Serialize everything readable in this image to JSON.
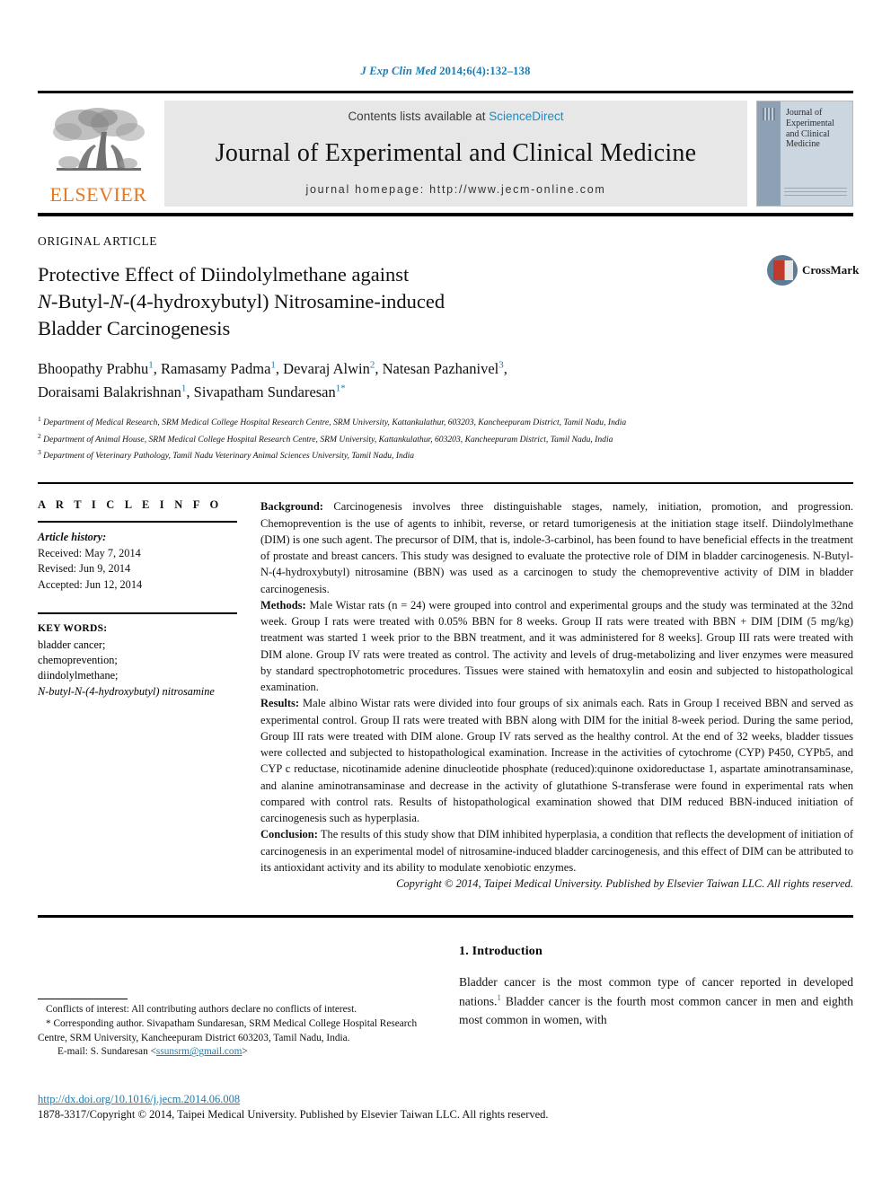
{
  "running_head": {
    "italic_part": "J Exp Clin Med",
    "rest": " 2014;6(4):132–138"
  },
  "masthead": {
    "contents_prefix": "Contents lists available at ",
    "sciencedirect": "ScienceDirect",
    "journal_name": "Journal of Experimental and Clinical Medicine",
    "homepage": "journal homepage: http://www.jecm-online.com",
    "elsevier_wordmark": "ELSEVIER",
    "cover_title": "Journal of Experimental and Clinical Medicine"
  },
  "article": {
    "kicker": "ORIGINAL ARTICLE",
    "title_line1": "Protective Effect of Diindolylmethane against",
    "title_line2_ital1": "N",
    "title_line2_mid": "-Butyl-",
    "title_line2_ital2": "N",
    "title_line2_end": "-(4-hydroxybutyl) Nitrosamine-induced",
    "title_line3": "Bladder Carcinogenesis",
    "crossmark_label": "CrossMark"
  },
  "authors": [
    {
      "name": "Bhoopathy Prabhu",
      "sup": "1",
      "sep": ", "
    },
    {
      "name": "Ramasamy Padma",
      "sup": "1",
      "sep": ", "
    },
    {
      "name": "Devaraj Alwin",
      "sup": "2",
      "sep": ", "
    },
    {
      "name": "Natesan Pazhanivel",
      "sup": "3",
      "sep": ", "
    },
    {
      "name": "Doraisami Balakrishnan",
      "sup": "1",
      "sep": ", "
    },
    {
      "name": "Sivapatham Sundaresan",
      "sup": "1",
      "star": "*",
      "sep": ""
    }
  ],
  "affiliations": [
    {
      "sup": "1",
      "text": "Department of Medical Research, SRM Medical College Hospital Research Centre, SRM University, Kattankulathur, 603203, Kancheepuram District, Tamil Nadu, India"
    },
    {
      "sup": "2",
      "text": "Department of Animal House, SRM Medical College Hospital Research Centre, SRM University, Kattankulathur, 603203, Kancheepuram District, Tamil Nadu, India"
    },
    {
      "sup": "3",
      "text": "Department of Veterinary Pathology, Tamil Nadu Veterinary Animal Sciences University, Tamil Nadu, India"
    }
  ],
  "article_info": {
    "heading": "A R T I C L E   I N F O",
    "history_label": "Article history:",
    "received": "Received: May 7, 2014",
    "revised": "Revised: Jun 9, 2014",
    "accepted": "Accepted: Jun 12, 2014",
    "keywords_heading": "KEY WORDS:",
    "keywords": [
      {
        "text": "bladder cancer;",
        "italic": false
      },
      {
        "text": "chemoprevention;",
        "italic": false
      },
      {
        "text": "diindolylmethane;",
        "italic": false
      },
      {
        "text": "N-butyl-N-(4-hydroxybutyl) nitrosamine",
        "italic": true
      }
    ]
  },
  "abstract": {
    "background_label": "Background:",
    "background_text": " Carcinogenesis involves three distinguishable stages, namely, initiation, promotion, and progression. Chemoprevention is the use of agents to inhibit, reverse, or retard tumorigenesis at the initiation stage itself. Diindolylmethane (DIM) is one such agent. The precursor of DIM, that is, indole-3-carbinol, has been found to have beneficial effects in the treatment of prostate and breast cancers. This study was designed to evaluate the protective role of DIM in bladder carcinogenesis. N-Butyl-N-(4-hydroxybutyl) nitrosamine (BBN) was used as a carcinogen to study the chemopreventive activity of DIM in bladder carcinogenesis.",
    "methods_label": "Methods:",
    "methods_text": " Male Wistar rats (n = 24) were grouped into control and experimental groups and the study was terminated at the 32nd week. Group I rats were treated with 0.05% BBN for 8 weeks. Group II rats were treated with BBN + DIM [DIM (5 mg/kg) treatment was started 1 week prior to the BBN treatment, and it was administered for 8 weeks]. Group III rats were treated with DIM alone. Group IV rats were treated as control. The activity and levels of drug-metabolizing and liver enzymes were measured by standard spectrophotometric procedures. Tissues were stained with hematoxylin and eosin and subjected to histopathological examination.",
    "results_label": "Results:",
    "results_text": " Male albino Wistar rats were divided into four groups of six animals each. Rats in Group I received BBN and served as experimental control. Group II rats were treated with BBN along with DIM for the initial 8-week period. During the same period, Group III rats were treated with DIM alone. Group IV rats served as the healthy control. At the end of 32 weeks, bladder tissues were collected and subjected to histopathological examination. Increase in the activities of cytochrome (CYP) P450, CYPb5, and CYP c reductase, nicotinamide adenine dinucleotide phosphate (reduced):quinone oxidoreductase 1, aspartate aminotransaminase, and alanine aminotransaminase and decrease in the activity of glutathione S-transferase were found in experimental rats when compared with control rats. Results of histopathological examination showed that DIM reduced BBN-induced initiation of carcinogenesis such as hyperplasia.",
    "conclusion_label": "Conclusion:",
    "conclusion_text": " The results of this study show that DIM inhibited hyperplasia, a condition that reflects the development of initiation of carcinogenesis in an experimental model of nitrosamine-induced bladder carcinogenesis, and this effect of DIM can be attributed to its antioxidant activity and its ability to modulate xenobiotic enzymes.",
    "copyright": "Copyright © 2014, Taipei Medical University. Published by Elsevier Taiwan LLC. All rights reserved."
  },
  "footnotes": {
    "conflicts": "Conflicts of interest: All contributing authors declare no conflicts of interest.",
    "corresponding": "* Corresponding author. Sivapatham Sundaresan, SRM Medical College Hospital Research Centre, SRM University, Kancheepuram District 603203, Tamil Nadu, India.",
    "email_prefix": "E-mail: S. Sundaresan <",
    "email": "ssunsrm@gmail.com",
    "email_suffix": ">"
  },
  "introduction": {
    "heading": "1. Introduction",
    "paragraph_part1": "Bladder cancer is the most common type of cancer reported in developed nations.",
    "citation": "1",
    "paragraph_part2": " Bladder cancer is the fourth most common cancer in men and eighth most common in women, with"
  },
  "page_footer": {
    "doi": "http://dx.doi.org/10.1016/j.jecm.2014.06.008",
    "issn_copyright": "1878-3317/Copyright © 2014, Taipei Medical University. Published by Elsevier Taiwan LLC. All rights reserved."
  },
  "colors": {
    "link_blue": "#1a7bb0",
    "sciencedirect_blue": "#1a8cc4",
    "elsevier_orange": "#E87722",
    "band_gray": "#e7e7e7"
  }
}
